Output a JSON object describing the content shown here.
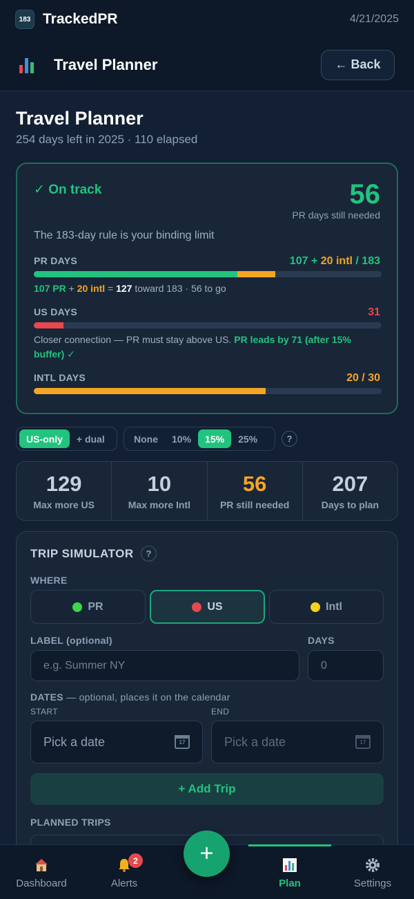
{
  "app": {
    "logo_text": "183",
    "name": "TrackedPR",
    "date": "4/21/2025"
  },
  "header": {
    "title": "Travel Planner",
    "back_label": "← Back"
  },
  "page": {
    "title": "Travel Planner",
    "subtitle": "254 days left in 2025 · 110 elapsed"
  },
  "status": {
    "state": "✓ On track",
    "needed_number": "56",
    "needed_label": "PR days still needed",
    "rule": "The 183-day rule is your binding limit",
    "pr": {
      "label": "PR DAYS",
      "value_pr": "107",
      "value_plus": " + ",
      "value_intl": "20 intl",
      "value_total": " / 183",
      "pr_fraction": 0.585,
      "intl_fraction": 0.109,
      "note_pr": "107 PR",
      "note_plus": " + ",
      "note_intl": "20 intl",
      "note_eq": " = ",
      "note_total": "127",
      "note_rest": " toward 183 · 56 to go"
    },
    "us": {
      "label": "US DAYS",
      "value": "31",
      "fraction": 0.085,
      "note": "Closer connection — PR must stay above US. ",
      "note_strong": "PR leads by 71 (after 15% buffer) ✓"
    },
    "intl": {
      "label": "INTL DAYS",
      "value": "20 / 30",
      "fraction": 0.667
    }
  },
  "mode_toggle": {
    "options": [
      "US-only",
      "+ dual"
    ],
    "selected": "US-only"
  },
  "buffer_toggle": {
    "options": [
      "None",
      "10%",
      "15%",
      "25%"
    ],
    "selected": "15%"
  },
  "help_mark": "?",
  "stats": [
    {
      "value": "129",
      "label": "Max more US",
      "color": "#c4d0de"
    },
    {
      "value": "10",
      "label": "Max more Intl",
      "color": "#c4d0de"
    },
    {
      "value": "56",
      "label": "PR still needed",
      "color": "#f5a524"
    },
    {
      "value": "207",
      "label": "Days to plan",
      "color": "#c4d0de"
    }
  ],
  "simulator": {
    "title": "TRIP SIMULATOR",
    "where_label": "WHERE",
    "where_options": [
      {
        "label": "PR",
        "dot_color": "#3fd44a"
      },
      {
        "label": "US",
        "dot_color": "#e5484d"
      },
      {
        "label": "Intl",
        "dot_color": "#f5d020"
      }
    ],
    "where_selected": "US",
    "label_field_label": "LABEL (optional)",
    "label_placeholder": "e.g. Summer NY",
    "days_label": "DAYS",
    "days_value": "0",
    "dates_label": "DATES",
    "dates_hint": " — optional, places it on the calendar",
    "start_label": "START",
    "end_label": "END",
    "start_placeholder": "Pick a date",
    "end_placeholder": "Pick a date",
    "add_button": "+ Add Trip",
    "planned_label": "PLANNED TRIPS"
  },
  "nav": {
    "items": [
      {
        "label": "Dashboard",
        "icon": "house-icon"
      },
      {
        "label": "Alerts",
        "icon": "bell-icon",
        "badge": "2"
      },
      {
        "label": "Plan",
        "icon": "chart-icon"
      },
      {
        "label": "Settings",
        "icon": "gear-icon"
      }
    ],
    "active": "Plan",
    "fab_label": "+"
  },
  "colors": {
    "green": "#22c37e",
    "orange": "#f5a524",
    "red": "#e5484d",
    "bg": "#132033"
  }
}
